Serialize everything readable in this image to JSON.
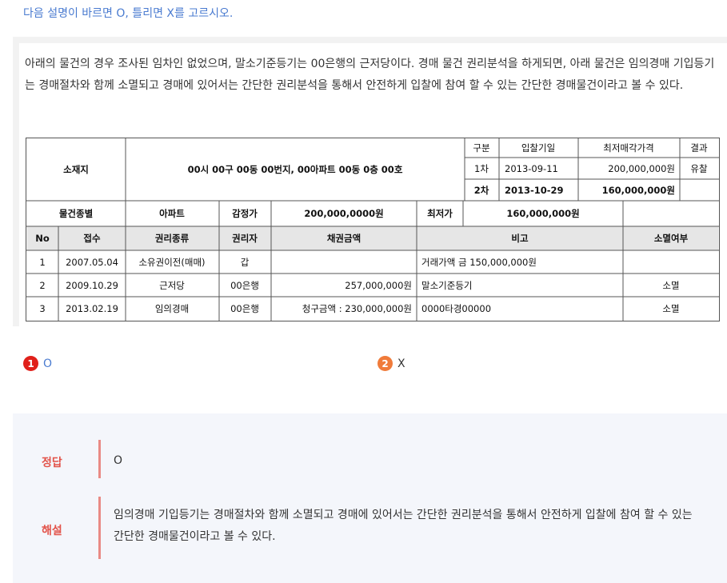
{
  "question": "다음 설명이 바르면 O, 틀리면 X를 고르시오.",
  "passage": "아래의 물건의 경우 조사된 임차인 없었으며, 말소기준등기는 00은행의 근저당이다. 경매 물건 권리분석을 하게되면, 아래 물건은 임의경매 기입등기는 경매절차와 함께 소멸되고 경매에 있어서는 간단한 권리분석을 통해서 안전하게 입찰에 참여 할 수 있는 간단한 경매물건이라고 볼 수 있다.",
  "table": {
    "location_label": "소재지",
    "location_value": "00시 00구 00동 00번지, 00아파트 00동 0층 00호",
    "round_header": "구분",
    "date_header": "입찰기일",
    "min_price_header": "최저매각가격",
    "result_header": "결과",
    "rounds": [
      {
        "round": "1차",
        "date": "2013-09-11",
        "price": "200,000,000원",
        "result": "유찰"
      },
      {
        "round": "2차",
        "date": "2013-10-29",
        "price": "160,000,000원",
        "result": ""
      }
    ],
    "type_label": "물건종별",
    "type_value": "아파트",
    "appraisal_label": "감정가",
    "appraisal_value": "200,000,0000원",
    "min_label": "최저가",
    "min_value": "160,000,000원",
    "columns": [
      "No",
      "접수",
      "권리종류",
      "권리자",
      "채권금액",
      "비고",
      "소멸여부"
    ],
    "rows": [
      {
        "no": "1",
        "date": "2007.05.04",
        "kind": "소유권이전(매매)",
        "holder": "갑",
        "amount": "",
        "note": "거래가액 금 150,000,000원",
        "status": ""
      },
      {
        "no": "2",
        "date": "2009.10.29",
        "kind": "근저당",
        "holder": "00은행",
        "amount": "257,000,000원",
        "note": "말소기준등기",
        "status": "소멸"
      },
      {
        "no": "3",
        "date": "2013.02.19",
        "kind": "임의경매",
        "holder": "00은행",
        "amount": "청구금액 : 230,000,000원",
        "note": "0000타경00000",
        "status": "소멸"
      }
    ]
  },
  "choices": [
    {
      "num": "1",
      "label": "O",
      "color": "#e0201a"
    },
    {
      "num": "2",
      "label": "X",
      "color": "#f07b3a"
    }
  ],
  "answer": {
    "label": "정답",
    "value": "O",
    "explanation_label": "해설",
    "explanation": "임의경매 기입등기는 경매절차와 함께 소멸되고 경매에 있어서는 간단한 권리분석을 통해서 안전하게 입찰에 참여 할 수 있는 간단한 경매물건이라고 볼 수 있다."
  }
}
